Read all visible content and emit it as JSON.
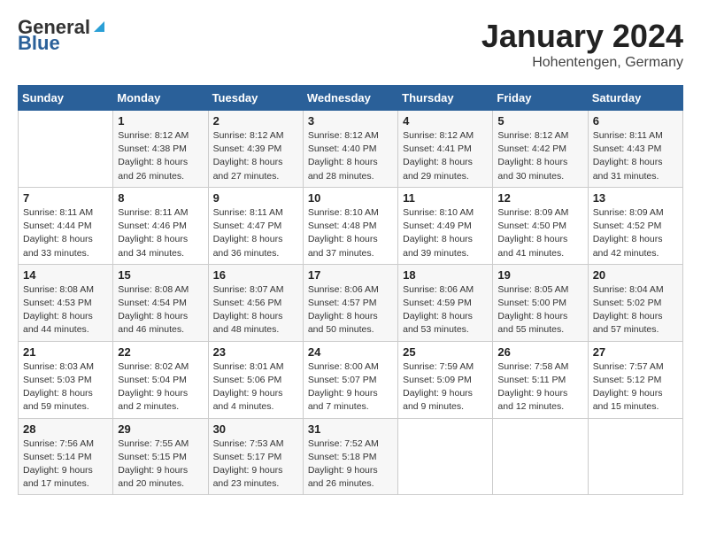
{
  "header": {
    "logo_general": "General",
    "logo_blue": "Blue",
    "month": "January 2024",
    "location": "Hohentengen, Germany"
  },
  "weekdays": [
    "Sunday",
    "Monday",
    "Tuesday",
    "Wednesday",
    "Thursday",
    "Friday",
    "Saturday"
  ],
  "weeks": [
    [
      {
        "day": "",
        "sunrise": "",
        "sunset": "",
        "daylight": ""
      },
      {
        "day": "1",
        "sunrise": "Sunrise: 8:12 AM",
        "sunset": "Sunset: 4:38 PM",
        "daylight": "Daylight: 8 hours and 26 minutes."
      },
      {
        "day": "2",
        "sunrise": "Sunrise: 8:12 AM",
        "sunset": "Sunset: 4:39 PM",
        "daylight": "Daylight: 8 hours and 27 minutes."
      },
      {
        "day": "3",
        "sunrise": "Sunrise: 8:12 AM",
        "sunset": "Sunset: 4:40 PM",
        "daylight": "Daylight: 8 hours and 28 minutes."
      },
      {
        "day": "4",
        "sunrise": "Sunrise: 8:12 AM",
        "sunset": "Sunset: 4:41 PM",
        "daylight": "Daylight: 8 hours and 29 minutes."
      },
      {
        "day": "5",
        "sunrise": "Sunrise: 8:12 AM",
        "sunset": "Sunset: 4:42 PM",
        "daylight": "Daylight: 8 hours and 30 minutes."
      },
      {
        "day": "6",
        "sunrise": "Sunrise: 8:11 AM",
        "sunset": "Sunset: 4:43 PM",
        "daylight": "Daylight: 8 hours and 31 minutes."
      }
    ],
    [
      {
        "day": "7",
        "sunrise": "Sunrise: 8:11 AM",
        "sunset": "Sunset: 4:44 PM",
        "daylight": "Daylight: 8 hours and 33 minutes."
      },
      {
        "day": "8",
        "sunrise": "Sunrise: 8:11 AM",
        "sunset": "Sunset: 4:46 PM",
        "daylight": "Daylight: 8 hours and 34 minutes."
      },
      {
        "day": "9",
        "sunrise": "Sunrise: 8:11 AM",
        "sunset": "Sunset: 4:47 PM",
        "daylight": "Daylight: 8 hours and 36 minutes."
      },
      {
        "day": "10",
        "sunrise": "Sunrise: 8:10 AM",
        "sunset": "Sunset: 4:48 PM",
        "daylight": "Daylight: 8 hours and 37 minutes."
      },
      {
        "day": "11",
        "sunrise": "Sunrise: 8:10 AM",
        "sunset": "Sunset: 4:49 PM",
        "daylight": "Daylight: 8 hours and 39 minutes."
      },
      {
        "day": "12",
        "sunrise": "Sunrise: 8:09 AM",
        "sunset": "Sunset: 4:50 PM",
        "daylight": "Daylight: 8 hours and 41 minutes."
      },
      {
        "day": "13",
        "sunrise": "Sunrise: 8:09 AM",
        "sunset": "Sunset: 4:52 PM",
        "daylight": "Daylight: 8 hours and 42 minutes."
      }
    ],
    [
      {
        "day": "14",
        "sunrise": "Sunrise: 8:08 AM",
        "sunset": "Sunset: 4:53 PM",
        "daylight": "Daylight: 8 hours and 44 minutes."
      },
      {
        "day": "15",
        "sunrise": "Sunrise: 8:08 AM",
        "sunset": "Sunset: 4:54 PM",
        "daylight": "Daylight: 8 hours and 46 minutes."
      },
      {
        "day": "16",
        "sunrise": "Sunrise: 8:07 AM",
        "sunset": "Sunset: 4:56 PM",
        "daylight": "Daylight: 8 hours and 48 minutes."
      },
      {
        "day": "17",
        "sunrise": "Sunrise: 8:06 AM",
        "sunset": "Sunset: 4:57 PM",
        "daylight": "Daylight: 8 hours and 50 minutes."
      },
      {
        "day": "18",
        "sunrise": "Sunrise: 8:06 AM",
        "sunset": "Sunset: 4:59 PM",
        "daylight": "Daylight: 8 hours and 53 minutes."
      },
      {
        "day": "19",
        "sunrise": "Sunrise: 8:05 AM",
        "sunset": "Sunset: 5:00 PM",
        "daylight": "Daylight: 8 hours and 55 minutes."
      },
      {
        "day": "20",
        "sunrise": "Sunrise: 8:04 AM",
        "sunset": "Sunset: 5:02 PM",
        "daylight": "Daylight: 8 hours and 57 minutes."
      }
    ],
    [
      {
        "day": "21",
        "sunrise": "Sunrise: 8:03 AM",
        "sunset": "Sunset: 5:03 PM",
        "daylight": "Daylight: 8 hours and 59 minutes."
      },
      {
        "day": "22",
        "sunrise": "Sunrise: 8:02 AM",
        "sunset": "Sunset: 5:04 PM",
        "daylight": "Daylight: 9 hours and 2 minutes."
      },
      {
        "day": "23",
        "sunrise": "Sunrise: 8:01 AM",
        "sunset": "Sunset: 5:06 PM",
        "daylight": "Daylight: 9 hours and 4 minutes."
      },
      {
        "day": "24",
        "sunrise": "Sunrise: 8:00 AM",
        "sunset": "Sunset: 5:07 PM",
        "daylight": "Daylight: 9 hours and 7 minutes."
      },
      {
        "day": "25",
        "sunrise": "Sunrise: 7:59 AM",
        "sunset": "Sunset: 5:09 PM",
        "daylight": "Daylight: 9 hours and 9 minutes."
      },
      {
        "day": "26",
        "sunrise": "Sunrise: 7:58 AM",
        "sunset": "Sunset: 5:11 PM",
        "daylight": "Daylight: 9 hours and 12 minutes."
      },
      {
        "day": "27",
        "sunrise": "Sunrise: 7:57 AM",
        "sunset": "Sunset: 5:12 PM",
        "daylight": "Daylight: 9 hours and 15 minutes."
      }
    ],
    [
      {
        "day": "28",
        "sunrise": "Sunrise: 7:56 AM",
        "sunset": "Sunset: 5:14 PM",
        "daylight": "Daylight: 9 hours and 17 minutes."
      },
      {
        "day": "29",
        "sunrise": "Sunrise: 7:55 AM",
        "sunset": "Sunset: 5:15 PM",
        "daylight": "Daylight: 9 hours and 20 minutes."
      },
      {
        "day": "30",
        "sunrise": "Sunrise: 7:53 AM",
        "sunset": "Sunset: 5:17 PM",
        "daylight": "Daylight: 9 hours and 23 minutes."
      },
      {
        "day": "31",
        "sunrise": "Sunrise: 7:52 AM",
        "sunset": "Sunset: 5:18 PM",
        "daylight": "Daylight: 9 hours and 26 minutes."
      },
      {
        "day": "",
        "sunrise": "",
        "sunset": "",
        "daylight": ""
      },
      {
        "day": "",
        "sunrise": "",
        "sunset": "",
        "daylight": ""
      },
      {
        "day": "",
        "sunrise": "",
        "sunset": "",
        "daylight": ""
      }
    ]
  ]
}
